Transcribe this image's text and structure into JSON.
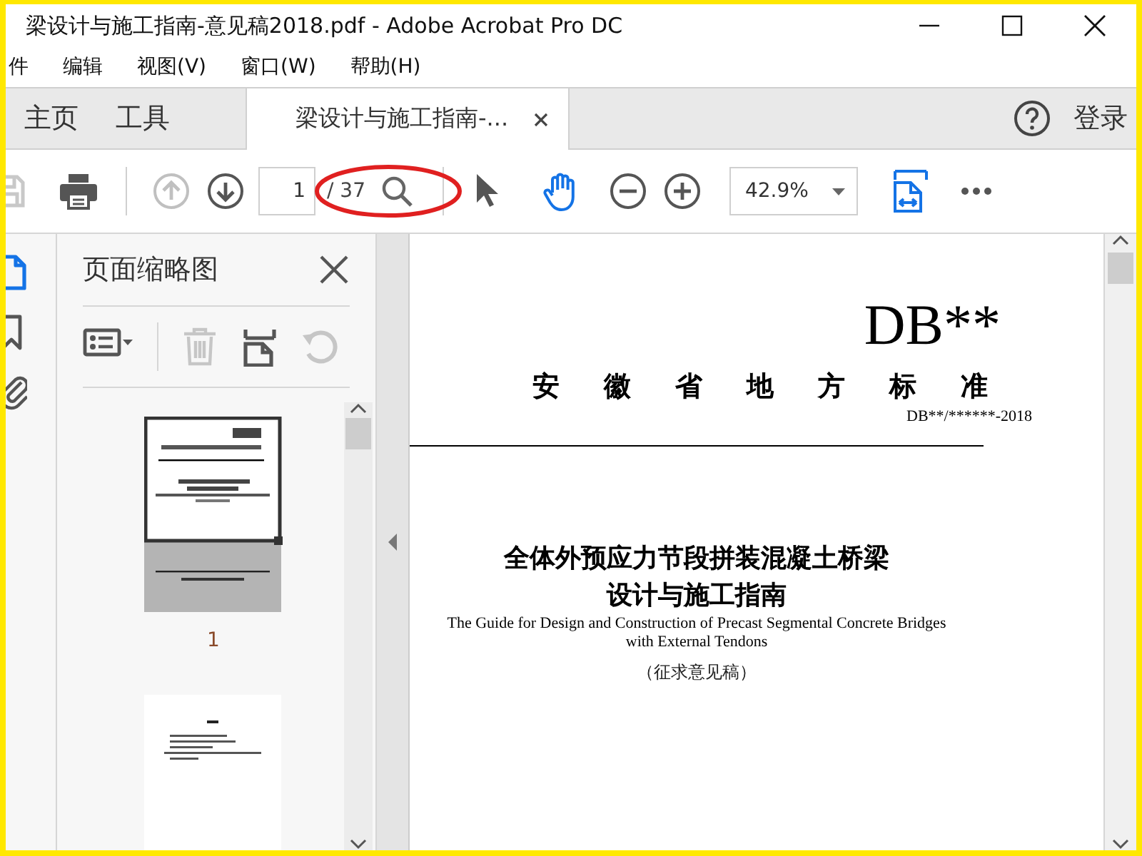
{
  "window": {
    "title": "梁设计与施工指南-意见稿2018.pdf - Adobe Acrobat Pro DC"
  },
  "menu": [
    "件",
    "编辑",
    "视图(V)",
    "窗口(W)",
    "帮助(H)"
  ],
  "tabs": [
    {
      "label": "主页",
      "kind": "home",
      "selected": false
    },
    {
      "label": "工具",
      "kind": "home",
      "selected": false
    },
    {
      "label": "梁设计与施工指南-...",
      "kind": "document",
      "selected": true
    }
  ],
  "sign_in": "登录",
  "toolbar": {
    "save_disabled": true,
    "prev_disabled": true,
    "next_disabled": false,
    "page": "1",
    "page_count": "/ 37",
    "zoom": "42.9%",
    "tools": [
      {
        "kind": "select",
        "selected": false
      },
      {
        "kind": "hand",
        "selected": true
      }
    ]
  },
  "nav_icons": [
    {
      "kind": "pages",
      "selected": true
    },
    {
      "kind": "bookmarks",
      "selected": false
    },
    {
      "kind": "attachments",
      "selected": false
    }
  ],
  "side_panel": {
    "title": "页面缩略图",
    "tools": [
      {
        "kind": "options",
        "disabled": false
      },
      {
        "kind": "delete",
        "disabled": true
      },
      {
        "kind": "extract",
        "disabled": false
      },
      {
        "kind": "rotate",
        "disabled": true
      }
    ],
    "thumbnails": [
      {
        "kind": "cover",
        "label": "1",
        "selected": true
      },
      {
        "kind": "text",
        "selected": false
      }
    ]
  },
  "document": {
    "code": "DB**",
    "issuer": "安徽省地方标准",
    "number": "DB**/******-2018",
    "title_lines": [
      "全体外预应力节段拼装混凝土桥梁",
      "设计与施工指南"
    ],
    "english_lines": [
      "The Guide for Design and Construction of Precast Segmental Concrete Bridges",
      "with External Tendons"
    ],
    "status": "（征求意见稿）"
  }
}
